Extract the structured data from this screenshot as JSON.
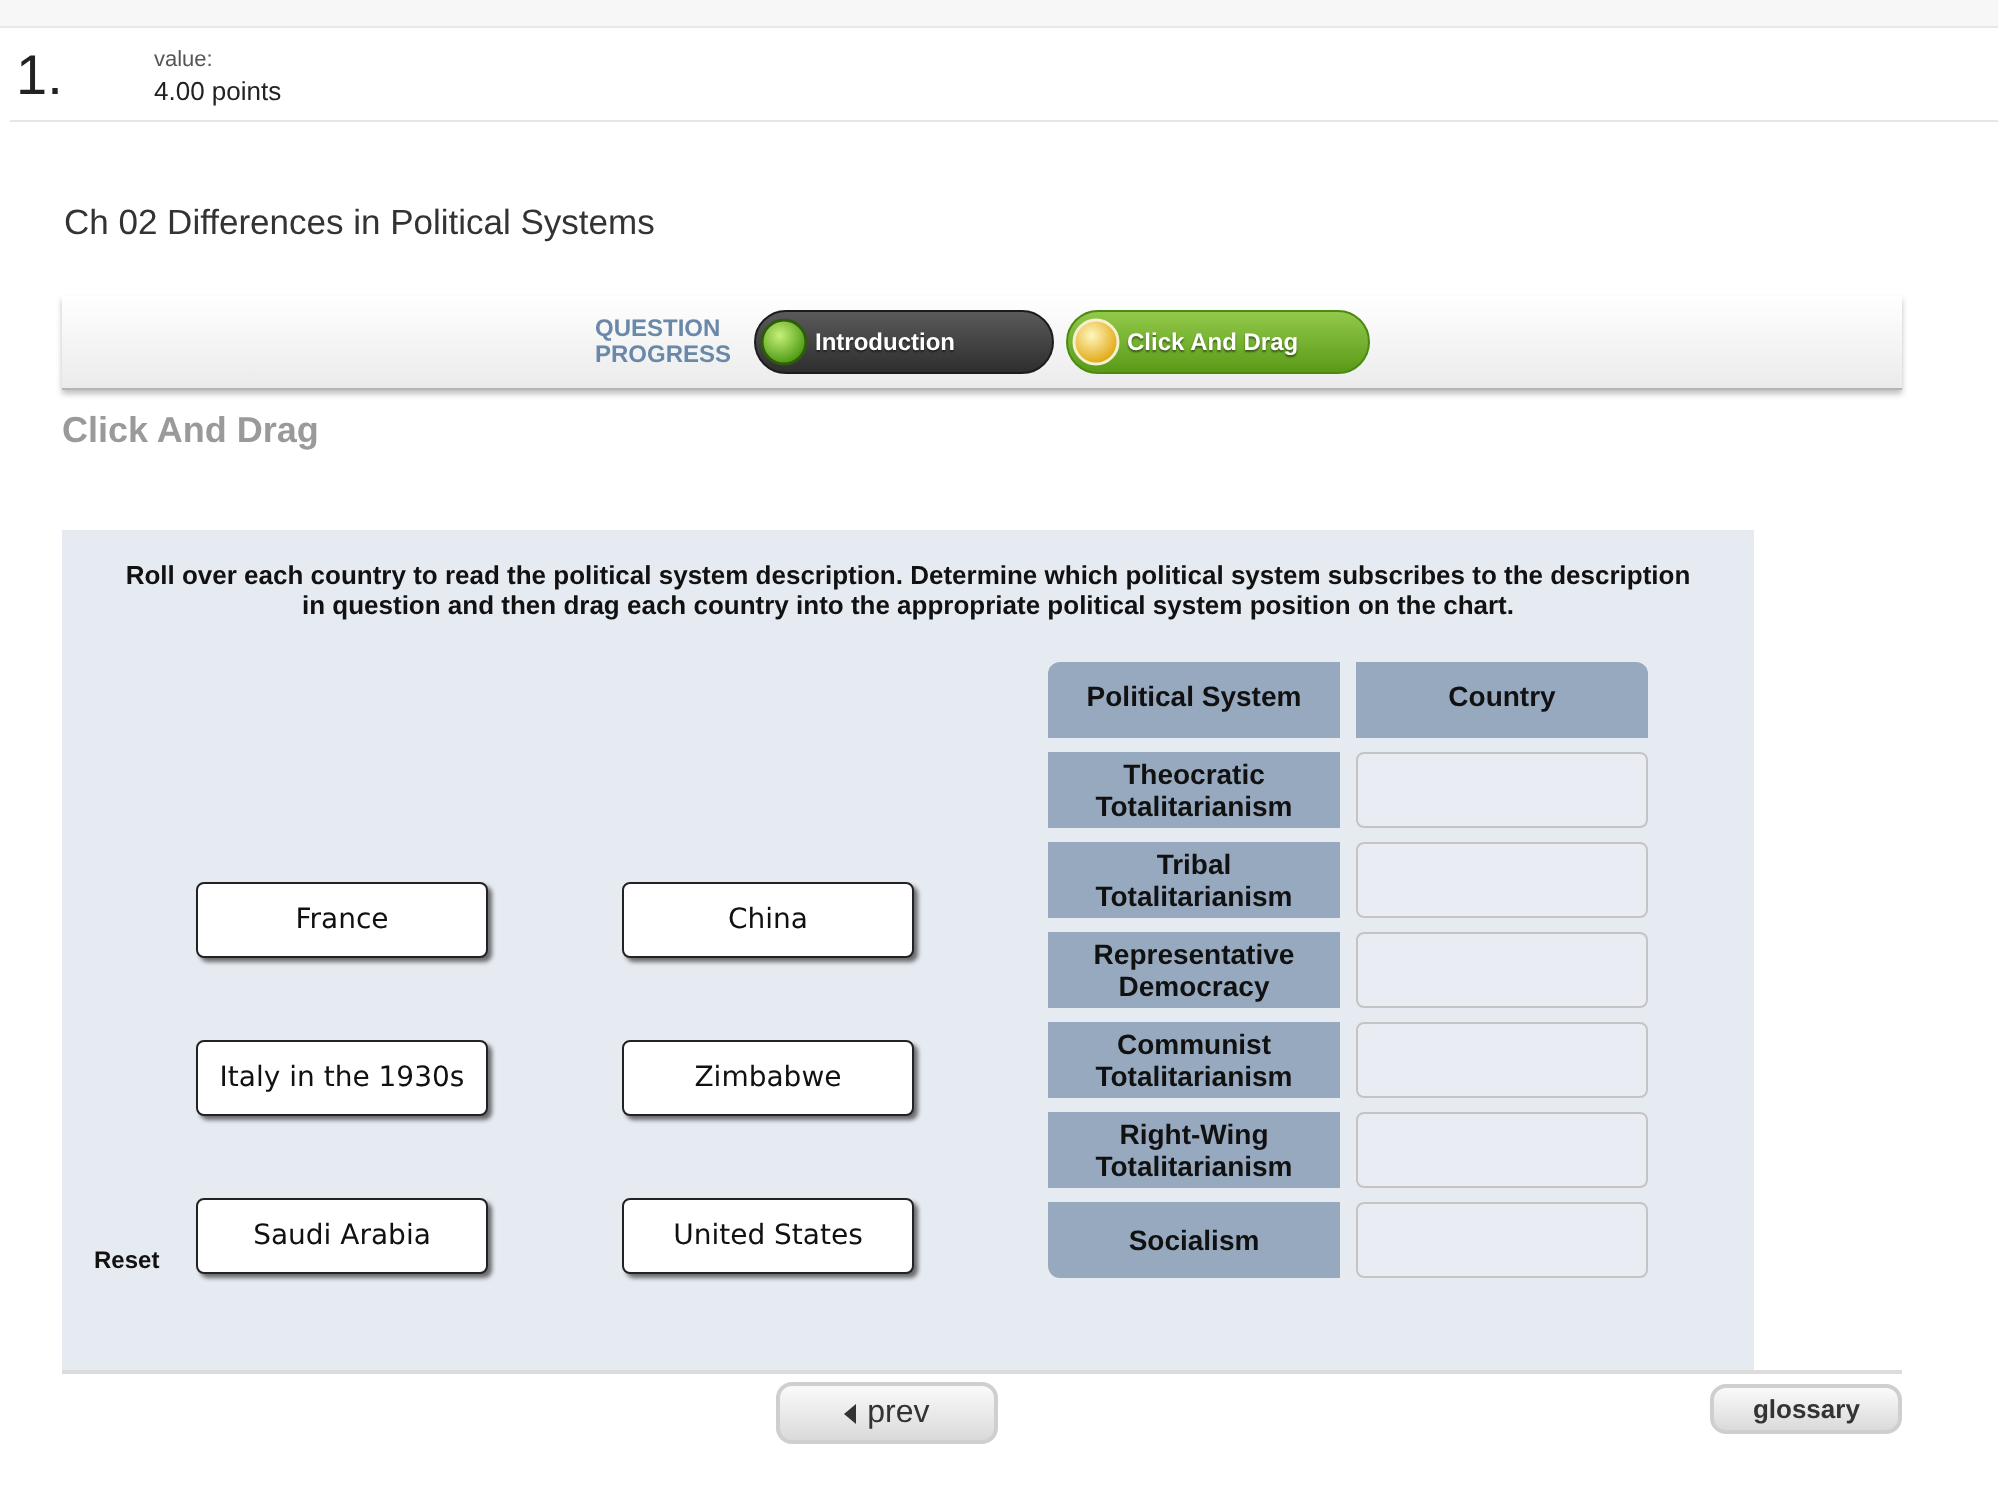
{
  "question": {
    "number": "1.",
    "value_label": "value:",
    "points": "4.00 points"
  },
  "title": "Ch 02 Differences in Political Systems",
  "progress": {
    "label": "QUESTION PROGRESS",
    "steps": [
      {
        "label": "Introduction",
        "selected": false
      },
      {
        "label": "Click And Drag",
        "selected": true
      }
    ]
  },
  "section_heading": "Click And Drag",
  "activity": {
    "instructions": "Roll over each country to read the political system description. Determine which political system subscribes to the description in question and then drag each country into the appropriate political system position on the chart.",
    "reset": "Reset",
    "countries": [
      "France",
      "China",
      "Italy in the 1930s",
      "Zimbabwe",
      "Saudi Arabia",
      "United States"
    ],
    "table": {
      "columns": [
        "Political System",
        "Country"
      ],
      "rows": [
        "Theocratic Totalitarianism",
        "Tribal Totalitarianism",
        "Representative Democracy",
        "Communist Totalitarianism",
        "Right-Wing Totalitarianism",
        "Socialism"
      ]
    }
  },
  "nav": {
    "prev": "prev",
    "glossary": "glossary"
  }
}
